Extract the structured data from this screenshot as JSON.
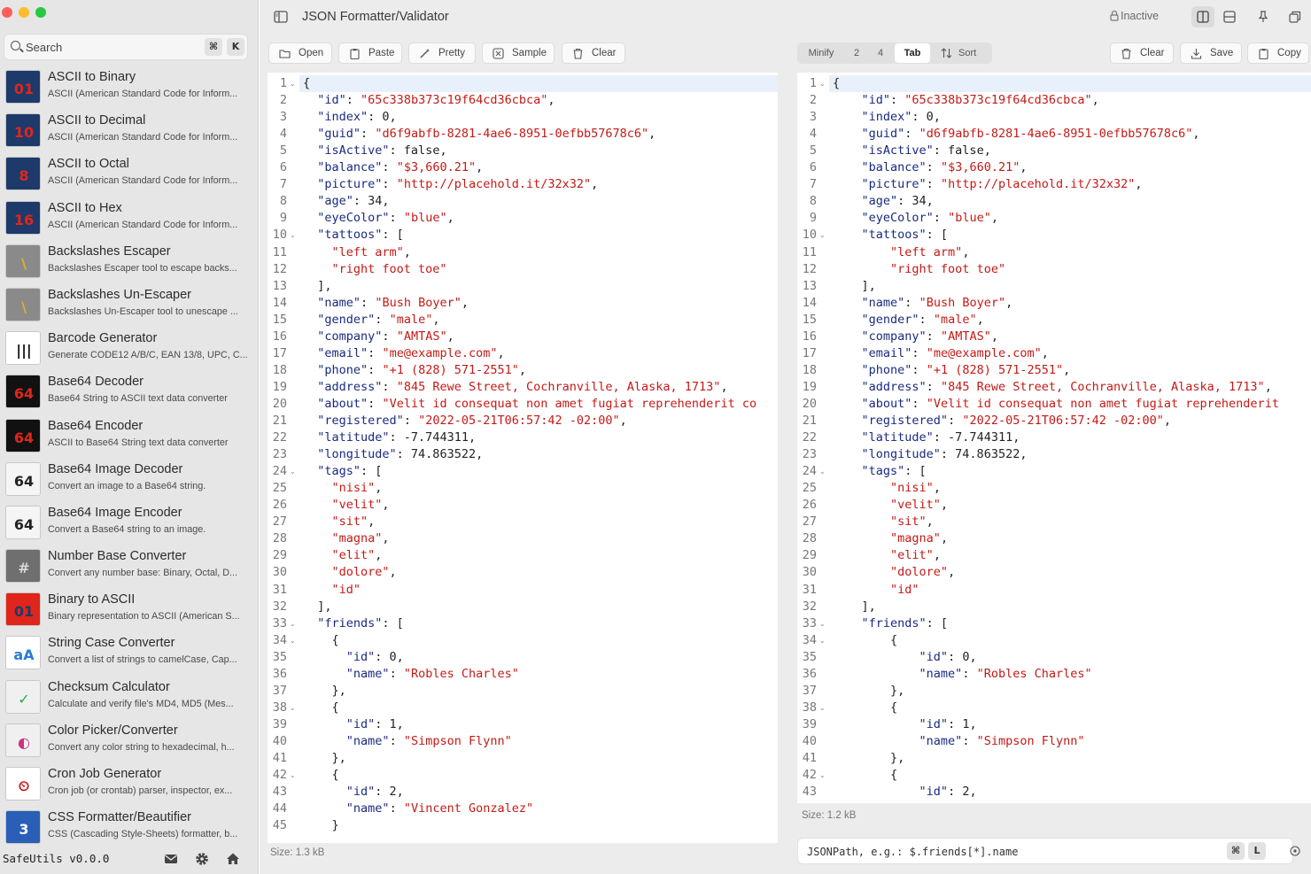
{
  "app": {
    "name": "SafeUtils",
    "version": "SafeUtils v0.0.0"
  },
  "search": {
    "placeholder": "Search",
    "shortcut": [
      "⌘",
      "K"
    ]
  },
  "tools": [
    {
      "name": "ASCII to Binary",
      "desc": "ASCII (American Standard Code for Inform...",
      "icon": "ascii-to-binary-icon"
    },
    {
      "name": "ASCII to Decimal",
      "desc": "ASCII (American Standard Code for Inform...",
      "icon": "ascii-to-decimal-icon"
    },
    {
      "name": "ASCII to Octal",
      "desc": "ASCII (American Standard Code for Inform...",
      "icon": "ascii-to-octal-icon"
    },
    {
      "name": "ASCII to Hex",
      "desc": "ASCII (American Standard Code for Inform...",
      "icon": "ascii-to-hex-icon"
    },
    {
      "name": "Backslashes Escaper",
      "desc": "Backslashes Escaper tool to escape backs...",
      "icon": "backslash-escaper-icon"
    },
    {
      "name": "Backslashes Un-Escaper",
      "desc": "Backslashes Un-Escaper tool to unescape ...",
      "icon": "backslash-unescaper-icon"
    },
    {
      "name": "Barcode Generator",
      "desc": "Generate CODE12 A/B/C, EAN 13/8, UPC, C...",
      "icon": "barcode-icon"
    },
    {
      "name": "Base64 Decoder",
      "desc": "Base64 String to ASCII text data converter",
      "icon": "base64-decoder-icon"
    },
    {
      "name": "Base64 Encoder",
      "desc": "ASCII to Base64 String text data converter",
      "icon": "base64-encoder-icon"
    },
    {
      "name": "Base64 Image Decoder",
      "desc": "Convert an image to a Base64 string.",
      "icon": "base64-image-decoder-icon"
    },
    {
      "name": "Base64 Image Encoder",
      "desc": "Convert a Base64 string to an image.",
      "icon": "base64-image-encoder-icon"
    },
    {
      "name": "Number Base Converter",
      "desc": "Convert any number base: Binary, Octal, D...",
      "icon": "calculator-icon"
    },
    {
      "name": "Binary to ASCII",
      "desc": "Binary representation to ASCII (American S...",
      "icon": "binary-to-ascii-icon"
    },
    {
      "name": "String Case Converter",
      "desc": "Convert a list of strings to camelCase, Cap...",
      "icon": "string-case-icon"
    },
    {
      "name": "Checksum Calculator",
      "desc": "Calculate and verify file's MD4, MD5 (Mes...",
      "icon": "checksum-icon"
    },
    {
      "name": "Color Picker/Converter",
      "desc": "Convert any color string to hexadecimal, h...",
      "icon": "color-picker-icon"
    },
    {
      "name": "Cron Job Generator",
      "desc": "Cron job (or crontab) parser, inspector, ex...",
      "icon": "cron-clock-icon"
    },
    {
      "name": "CSS Formatter/Beautifier",
      "desc": "CSS (Cascading Style-Sheets) formatter, b...",
      "icon": "css-icon"
    }
  ],
  "header": {
    "title": "JSON Formatter/Validator",
    "status": "Inactive"
  },
  "left_toolbar": {
    "open": "Open",
    "paste": "Paste",
    "pretty": "Pretty",
    "sample": "Sample",
    "clear": "Clear"
  },
  "indent": {
    "minify": "Minify",
    "two": "2",
    "four": "4",
    "tab": "Tab",
    "selected": "Tab"
  },
  "right_toolbar": {
    "sort": "Sort",
    "clear": "Clear",
    "save": "Save",
    "copy": "Copy"
  },
  "input_editor": {
    "lines": [
      "{",
      "  \"id\": \"65c338b373c19f64cd36cbca\",",
      "  \"index\": 0,",
      "  \"guid\": \"d6f9abfb-8281-4ae6-8951-0efbb57678c6\",",
      "  \"isActive\": false,",
      "  \"balance\": \"$3,660.21\",",
      "  \"picture\": \"http://placehold.it/32x32\",",
      "  \"age\": 34,",
      "  \"eyeColor\": \"blue\",",
      "  \"tattoos\": [",
      "    \"left arm\",",
      "    \"right foot toe\"",
      "  ],",
      "  \"name\": \"Bush Boyer\",",
      "  \"gender\": \"male\",",
      "  \"company\": \"AMTAS\",",
      "  \"email\": \"me@example.com\",",
      "  \"phone\": \"+1 (828) 571-2551\",",
      "  \"address\": \"845 Rewe Street, Cochranville, Alaska, 1713\",",
      "  \"about\": \"Velit id consequat non amet fugiat reprehenderit co",
      "  \"registered\": \"2022-05-21T06:57:42 -02:00\",",
      "  \"latitude\": -7.744311,",
      "  \"longitude\": 74.863522,",
      "  \"tags\": [",
      "    \"nisi\",",
      "    \"velit\",",
      "    \"sit\",",
      "    \"magna\",",
      "    \"elit\",",
      "    \"dolore\",",
      "    \"id\"",
      "  ],",
      "  \"friends\": [",
      "    {",
      "      \"id\": 0,",
      "      \"name\": \"Robles Charles\"",
      "    },",
      "    {",
      "      \"id\": 1,",
      "      \"name\": \"Simpson Flynn\"",
      "    },",
      "    {",
      "      \"id\": 2,",
      "      \"name\": \"Vincent Gonzalez\"",
      "    }"
    ],
    "fold_lines": [
      1,
      10,
      24,
      33,
      34,
      38,
      42
    ],
    "size": "Size: 1.3 kB"
  },
  "output_editor": {
    "lines": [
      "{",
      "\t\"id\": \"65c338b373c19f64cd36cbca\",",
      "\t\"index\": 0,",
      "\t\"guid\": \"d6f9abfb-8281-4ae6-8951-0efbb57678c6\",",
      "\t\"isActive\": false,",
      "\t\"balance\": \"$3,660.21\",",
      "\t\"picture\": \"http://placehold.it/32x32\",",
      "\t\"age\": 34,",
      "\t\"eyeColor\": \"blue\",",
      "\t\"tattoos\": [",
      "\t\t\"left arm\",",
      "\t\t\"right foot toe\"",
      "\t],",
      "\t\"name\": \"Bush Boyer\",",
      "\t\"gender\": \"male\",",
      "\t\"company\": \"AMTAS\",",
      "\t\"email\": \"me@example.com\",",
      "\t\"phone\": \"+1 (828) 571-2551\",",
      "\t\"address\": \"845 Rewe Street, Cochranville, Alaska, 1713\",",
      "\t\"about\": \"Velit id consequat non amet fugiat reprehenderit",
      "\t\"registered\": \"2022-05-21T06:57:42 -02:00\",",
      "\t\"latitude\": -7.744311,",
      "\t\"longitude\": 74.863522,",
      "\t\"tags\": [",
      "\t\t\"nisi\",",
      "\t\t\"velit\",",
      "\t\t\"sit\",",
      "\t\t\"magna\",",
      "\t\t\"elit\",",
      "\t\t\"dolore\",",
      "\t\t\"id\"",
      "\t],",
      "\t\"friends\": [",
      "\t\t{",
      "\t\t\t\"id\": 0,",
      "\t\t\t\"name\": \"Robles Charles\"",
      "\t\t},",
      "\t\t{",
      "\t\t\t\"id\": 1,",
      "\t\t\t\"name\": \"Simpson Flynn\"",
      "\t\t},",
      "\t\t{",
      "\t\t\t\"id\": 2,"
    ],
    "fold_lines": [
      1,
      10,
      24,
      33,
      34,
      38,
      42
    ],
    "size": "Size: 1.2 kB"
  },
  "jsonpath": {
    "placeholder": "JSONPath, e.g.: $.friends[*].name",
    "shortcut": [
      "⌘",
      "L"
    ]
  },
  "colors": {
    "key": "#1a2a80",
    "string": "#c41a16",
    "sidebar_bg": "#e6e6e6",
    "line_highlight": "#e8f0fb"
  }
}
